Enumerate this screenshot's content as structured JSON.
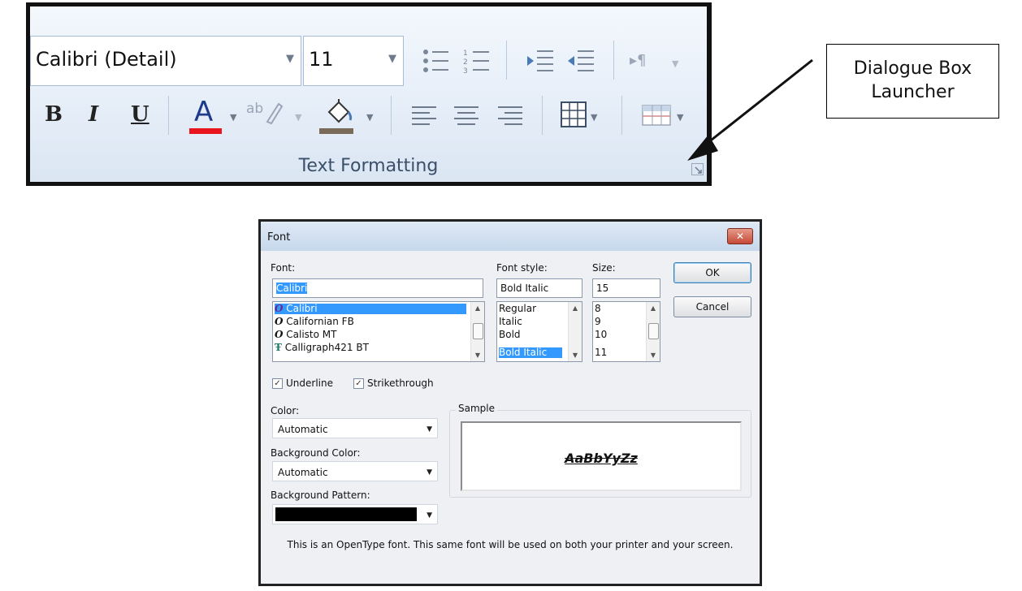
{
  "ribbon": {
    "font_name": "Calibri (Detail)",
    "font_size": "11",
    "group_label": "Text Formatting",
    "bold_label": "B",
    "italic_label": "I",
    "underline_label": "U",
    "font_color_label": "A",
    "highlight_label": "ab",
    "font_color_accent": "#e8141e",
    "fill_color_accent": "#7a6a5a"
  },
  "callout": {
    "line1": "Dialogue Box",
    "line2": "Launcher"
  },
  "dialog": {
    "title": "Font",
    "close_label": "✕",
    "font_label": "Font:",
    "font_value": "Calibri",
    "font_list": [
      "Calibri",
      "Californian FB",
      "Calisto MT",
      "Calligraph421 BT"
    ],
    "style_label": "Font style:",
    "style_value": "Bold Italic",
    "style_list": [
      "Regular",
      "Italic",
      "Bold",
      "Bold Italic"
    ],
    "size_label": "Size:",
    "size_value": "15",
    "size_list": [
      "8",
      "9",
      "10",
      "11"
    ],
    "ok_label": "OK",
    "cancel_label": "Cancel",
    "underline_label": "Underline",
    "strikethrough_label": "Strikethrough",
    "underline_checked": true,
    "strikethrough_checked": true,
    "color_label": "Color:",
    "color_value": "Automatic",
    "bgcolor_label": "Background Color:",
    "bgcolor_value": "Automatic",
    "bgpattern_label": "Background Pattern:",
    "bgpattern_color": "#000000",
    "sample_label": "Sample",
    "sample_text": "AaBbYyZz",
    "description": "This is an OpenType font. This same font will be used on both your printer and your screen.",
    "selection_color": "#3399ff"
  }
}
